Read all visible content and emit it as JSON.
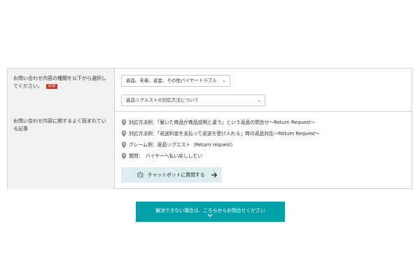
{
  "form": {
    "category": {
      "label": "お問い合わせ内容の種類を以下から選択してください。",
      "required_badge": "必須",
      "select1_value": "返品、未着、返金、その他バイヤートラブル",
      "select2_value": "返品リクエストの対応方法について"
    },
    "related": {
      "label": "お問い合わせ内容に関するよく読まれている記事",
      "articles": [
        "対応方法例：「届いた商品が商品説明と違う」という返品の問合せ～Return Request～",
        "対応方法例：「返送料金を支払って返送を受け入れる」時の返品対応～Return Request～",
        "クレーム例：返品リクエスト（Return request）",
        "質問：　バイヤーへ払い戻ししたい"
      ],
      "chatbot_button": "チャットボットに質問する"
    }
  },
  "contact_button": "解決できない場合は、こちらからお問合せください",
  "colors": {
    "accent": "#00a0a8",
    "badge": "#c0392b",
    "chatbot_bg": "#dcecef",
    "label_bg": "#f2f2f2"
  },
  "icons": {
    "article": "map-pin-icon",
    "chatbot": "robot-icon",
    "arrow": "arrow-right-icon",
    "contact_chevron": "chevron-down-icon",
    "select_chevron": "chevron-down-icon"
  }
}
